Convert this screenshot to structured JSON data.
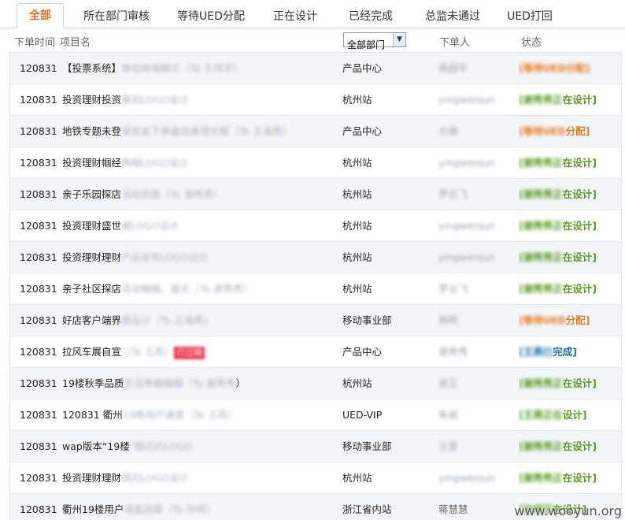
{
  "tabs": [
    {
      "label": "全部",
      "active": true
    },
    {
      "label": "所在部门审核",
      "active": false
    },
    {
      "label": "等待UED分配",
      "active": false
    },
    {
      "label": "正在设计",
      "active": false
    },
    {
      "label": "已经完成",
      "active": false
    },
    {
      "label": "总监未通过",
      "active": false
    },
    {
      "label": "UED打回",
      "active": false
    }
  ],
  "header": {
    "time": "下单时间",
    "name": "项目名",
    "dept_select": "全部部门",
    "person": "下单人",
    "status": "状态"
  },
  "rows": [
    {
      "time": "120831",
      "name": "【投票系统】",
      "name_blur": "移动商城模式（To 王伟宇）",
      "dept": "产品中心",
      "person": "高超宇",
      "status_blur": "[等待UED分配]",
      "status": "",
      "status_type": "wait"
    },
    {
      "time": "120831",
      "name": "投资理财投资",
      "name_blur": "策划LOGO设计",
      "dept": "杭州站",
      "person": "yingwenjun",
      "status_blur": "[谢秀秀正",
      "status": "在设计]",
      "status_type": "design"
    },
    {
      "time": "120831",
      "name": "地铁专题未登",
      "name_blur": "录状态下换盘改善提示框（To 王海燕）",
      "dept": "产品中心",
      "person": "方楠",
      "status_blur": "[等待UED",
      "status": "分配]",
      "status_type": "wait"
    },
    {
      "time": "120831",
      "name": "投资理财帼经",
      "name_blur": "典帼LOGO设计",
      "dept": "杭州站",
      "person": "yingwenjun",
      "status_blur": "[谢秀秀正",
      "status": "在设计]",
      "status_type": "design"
    },
    {
      "time": "120831",
      "name": "亲子乐园探店",
      "name_blur": "活动页面（To 谢秀秀）",
      "dept": "杭州站",
      "person": "罗云飞",
      "status_blur": "[谢秀秀正",
      "status": "在设计]",
      "status_type": "design"
    },
    {
      "time": "120831",
      "name": "投资理财盛世",
      "name_blur": "帼LOGO设计",
      "dept": "杭州站",
      "person": "yingwenjun",
      "status_blur": "[谢秀秀正",
      "status": "在设计]",
      "status_type": "design"
    },
    {
      "time": "120831",
      "name": "投资理财理财",
      "name_blur": "产品发布LOGO设计",
      "dept": "杭州站",
      "person": "yingwenjun",
      "status_blur": "[谢秀秀正",
      "status": "在设计]",
      "status_type": "design"
    },
    {
      "time": "120831",
      "name": "亲子社区探店",
      "name_blur": "活动帼帼、晨光（To 谢秀秀）",
      "dept": "杭州站",
      "person": "罗云飞",
      "status_blur": "[谢秀秀正",
      "status": "在设计]",
      "status_type": "design"
    },
    {
      "time": "120831",
      "name": "好店客户端界",
      "name_blur": "面设计（To 王海燕）",
      "dept": "移动事业部",
      "person": "杨明",
      "status_blur": "[等待UED",
      "status": "分配]",
      "status_type": "wait"
    },
    {
      "time": "120831",
      "name": "拉风车展自宣",
      "name_blur": "（To 王燕）",
      "tag": "已过期",
      "dept": "产品中心",
      "person": "谢秀秀",
      "status_blur": "[王燕已",
      "status": "完成]",
      "status_type": "done"
    },
    {
      "time": "120831",
      "name": "19楼秋季品质",
      "name_blur": "生活季帼帼帼（To 谢秀秀",
      "name_tail": "）",
      "dept": "杭州站",
      "person": "吴艾",
      "status_blur": "[谢秀秀正",
      "status": "在设计]",
      "status_type": "design"
    },
    {
      "time": "120831",
      "name": "120831 衢州",
      "name_blur": "19楼用户调查（To 王燕）",
      "dept": "UED-VIP",
      "person": "朱丽",
      "status_blur": "[王燕正在",
      "status": "设计]",
      "status_type": "design"
    },
    {
      "time": "120831",
      "name": "wap版本“19楼",
      "name_blur": "”帼式的LOGO",
      "dept": "移动事业部",
      "person": "王莹",
      "status_blur": "[谢秀秀正",
      "status": "在设计]",
      "status_type": "design"
    },
    {
      "time": "120831",
      "name": "投资理财理财",
      "name_blur": "顾问LOGO设计",
      "dept": "杭州站",
      "person": "yingwenjun",
      "status_blur": "[谢秀秀正",
      "status": "在设计]",
      "status_type": "design"
    },
    {
      "time": "120831",
      "name": "衢州19楼用户",
      "name_blur": "调查改版（To 孙柯）",
      "dept": "浙江省内站",
      "person": "蒋慧慧",
      "person_clear": true,
      "status_blur": "[孙柯正",
      "status": "在设计]",
      "status_type": "design"
    }
  ],
  "watermark": "www.wooyun.org"
}
